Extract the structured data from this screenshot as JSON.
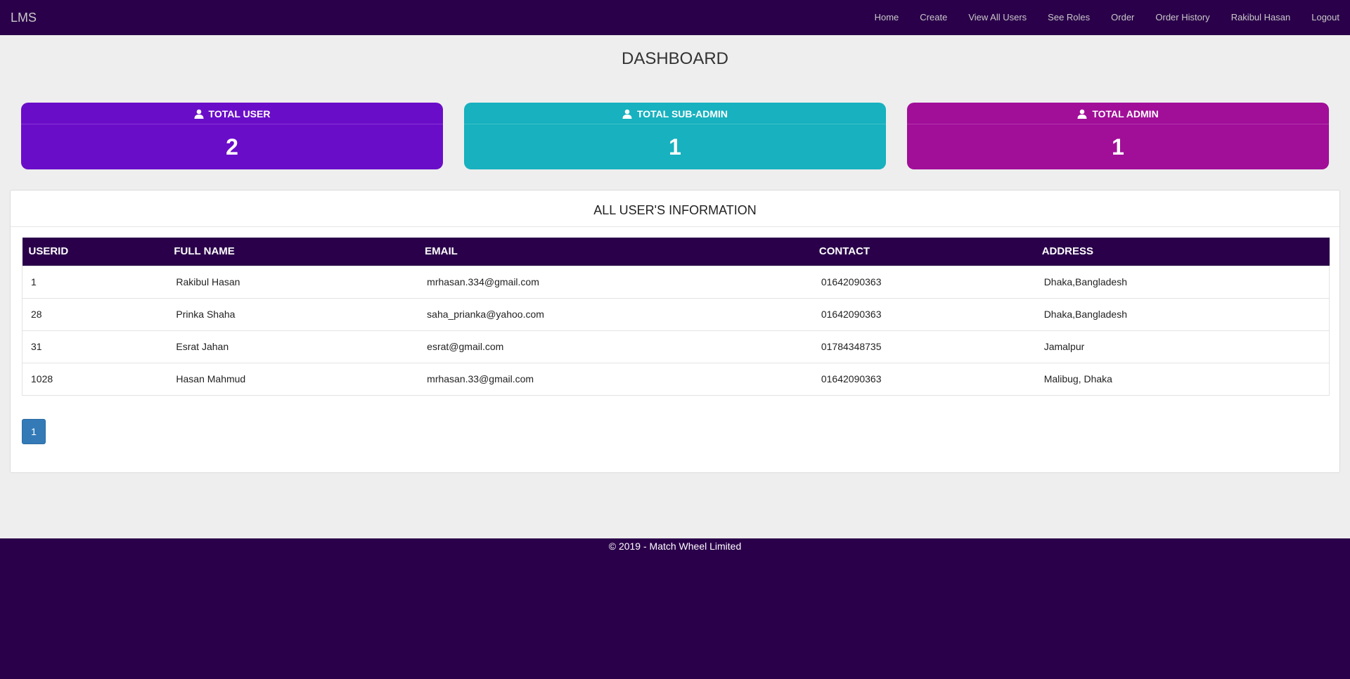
{
  "navbar": {
    "brand": "LMS",
    "items": [
      "Home",
      "Create",
      "View All Users",
      "See Roles",
      "Order",
      "Order History",
      "Rakibul Hasan",
      "Logout"
    ]
  },
  "dashboard": {
    "title": "DASHBOARD"
  },
  "stats": [
    {
      "label": "TOTAL USER",
      "value": "2",
      "color": "#6a0dc9",
      "icon": "user-icon"
    },
    {
      "label": "TOTAL SUB-ADMIN",
      "value": "1",
      "color": "#17b1bf",
      "icon": "user-icon"
    },
    {
      "label": "TOTAL ADMIN",
      "value": "1",
      "color": "#a10e98",
      "icon": "user-icon"
    }
  ],
  "users_panel": {
    "title": "ALL USER'S INFORMATION",
    "columns": [
      "USERID",
      "FULL NAME",
      "EMAIL",
      "CONTACT",
      "ADDRESS"
    ],
    "rows": [
      [
        "1",
        "Rakibul Hasan",
        "mrhasan.334@gmail.com",
        "01642090363",
        "Dhaka,Bangladesh"
      ],
      [
        "28",
        "Prinka Shaha",
        "saha_prianka@yahoo.com",
        "01642090363",
        "Dhaka,Bangladesh"
      ],
      [
        "31",
        "Esrat Jahan",
        "esrat@gmail.com",
        "01784348735",
        "Jamalpur"
      ],
      [
        "1028",
        "Hasan Mahmud",
        "mrhasan.33@gmail.com",
        "01642090363",
        "Malibug, Dhaka"
      ]
    ],
    "pagination": {
      "current": "1"
    }
  },
  "footer": {
    "text": "© 2019 - Match Wheel Limited"
  },
  "colors": {
    "navbar": "#2a004a",
    "pagination": "#337ab7"
  }
}
